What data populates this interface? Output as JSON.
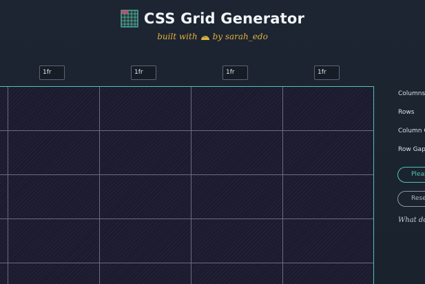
{
  "header": {
    "title": "CSS Grid Generator",
    "subtitle_prefix": "built with",
    "subtitle_suffix": "by sarah_edo",
    "logo_icon": "grid-logo-icon",
    "taco_icon": "taco-icon"
  },
  "columns": [
    {
      "value": "1fr"
    },
    {
      "value": "1fr"
    },
    {
      "value": "1fr"
    },
    {
      "value": "1fr"
    }
  ],
  "sidebar": {
    "columns_label": "Columns",
    "rows_label": "Rows",
    "column_gap_label": "Column G",
    "row_gap_label": "Row Gap (",
    "please_button": "Please",
    "reset_button": "Rese",
    "help_link": "What do"
  },
  "colors": {
    "accent": "#4fc7b5",
    "subtitle": "#e2b13c",
    "grid_lines": "#6b6d84",
    "background": "#1c2430"
  }
}
